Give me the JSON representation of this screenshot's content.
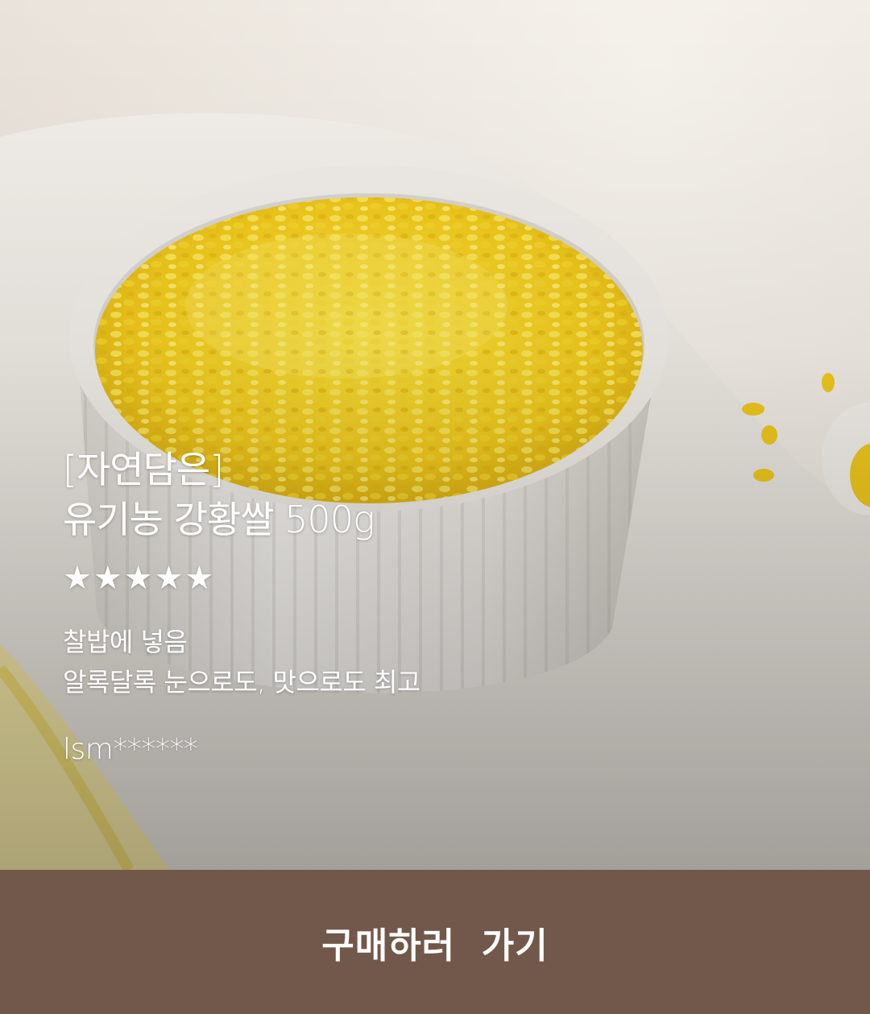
{
  "product": {
    "brand": "[자연담은]",
    "name": "유기농 강황쌀 500g",
    "rating": 5,
    "rating_max": 5,
    "star_glyph": "★",
    "review_lines": [
      "찰밥에 넣음",
      "알록달록 눈으로도, 맛으로도 최고"
    ],
    "author": "lsm******"
  },
  "cta": {
    "label": "구매하러  가기",
    "background": "#72584a"
  },
  "icons": {
    "star": "star-icon"
  }
}
